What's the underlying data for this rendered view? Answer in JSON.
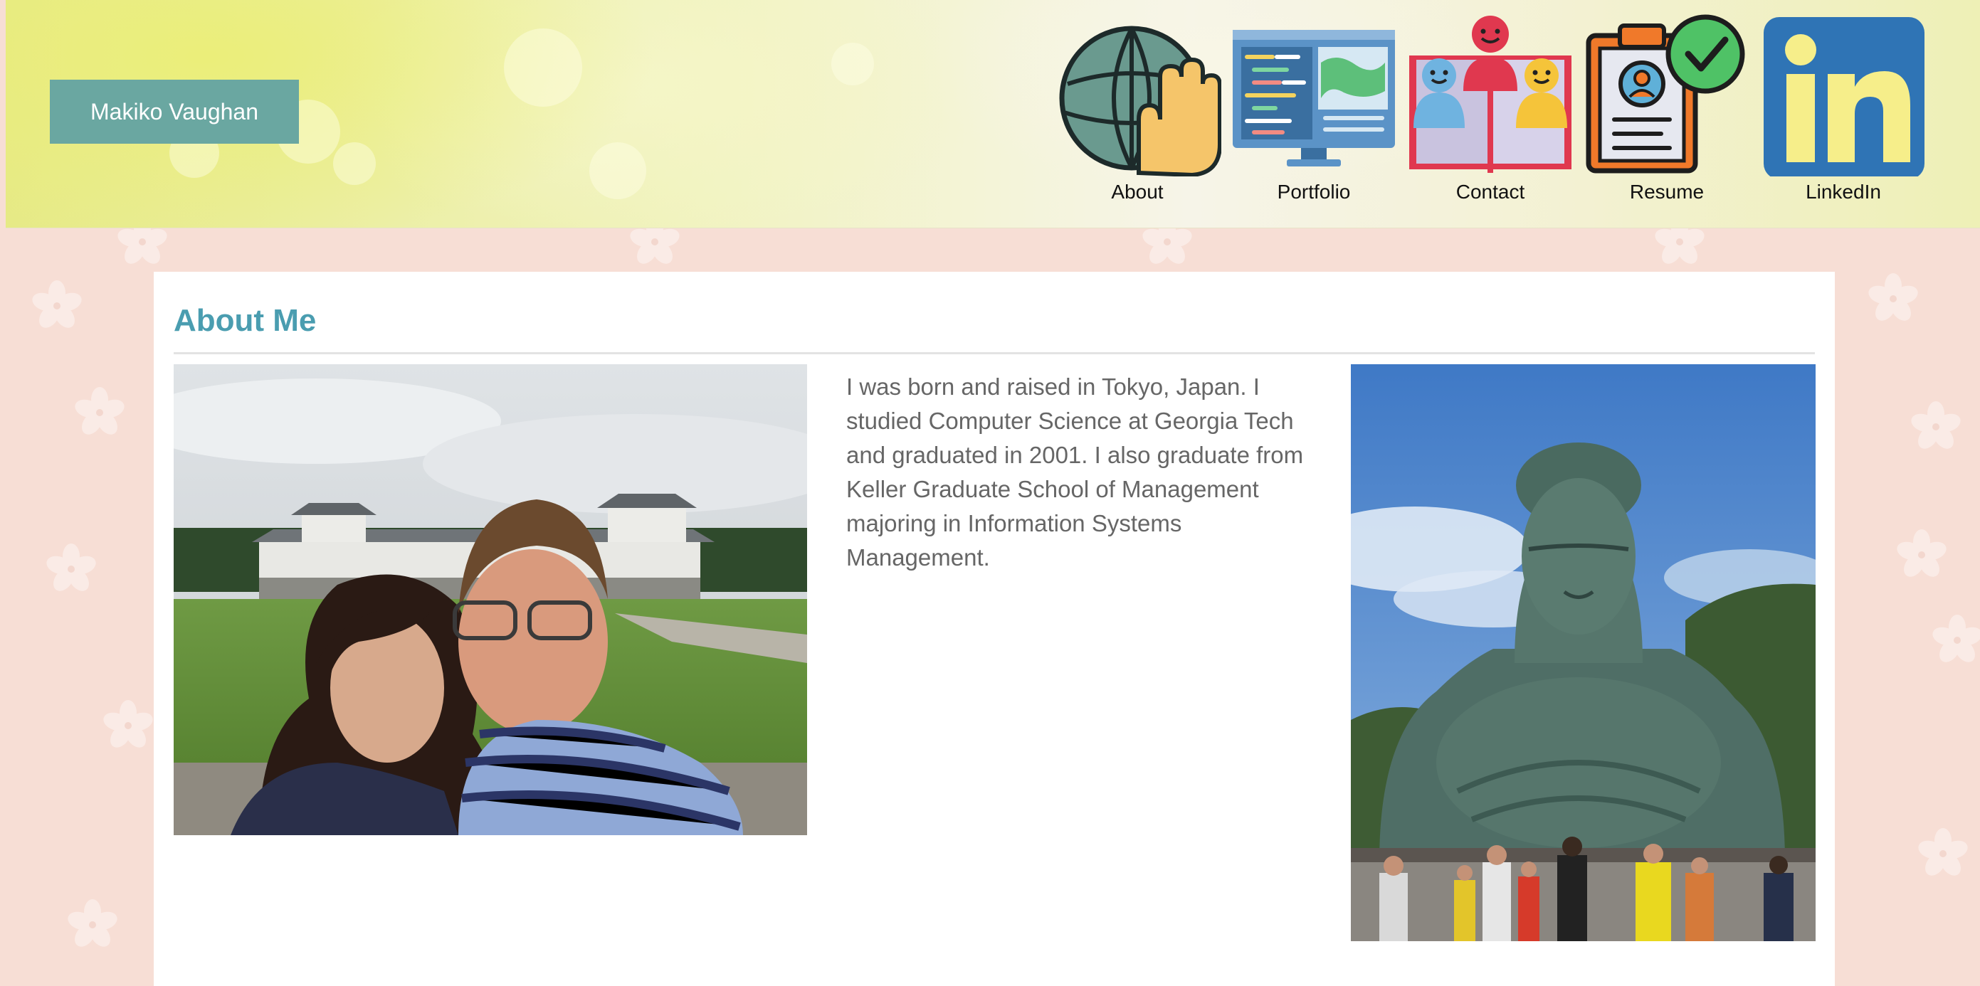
{
  "header": {
    "brand": "Makiko Vaughan",
    "nav": [
      {
        "label": "About",
        "icon": "globe-hand-icon"
      },
      {
        "label": "Portfolio",
        "icon": "code-monitor-icon"
      },
      {
        "label": "Contact",
        "icon": "people-book-icon"
      },
      {
        "label": "Resume",
        "icon": "clipboard-check-icon"
      },
      {
        "label": "LinkedIn",
        "icon": "linkedin-icon"
      }
    ]
  },
  "about": {
    "title": "About Me",
    "bio": "I was born and raised in Tokyo, Japan. I studied Computer Science at Georgia Tech and graduated in 2001. I also graduate from Keller Graduate School of Management majoring in Information Systems Management."
  },
  "colors": {
    "brand_button": "#6aa7a1",
    "title": "#4a9db0",
    "background": "#f7ded5",
    "linkedin": "#2f74b5"
  }
}
